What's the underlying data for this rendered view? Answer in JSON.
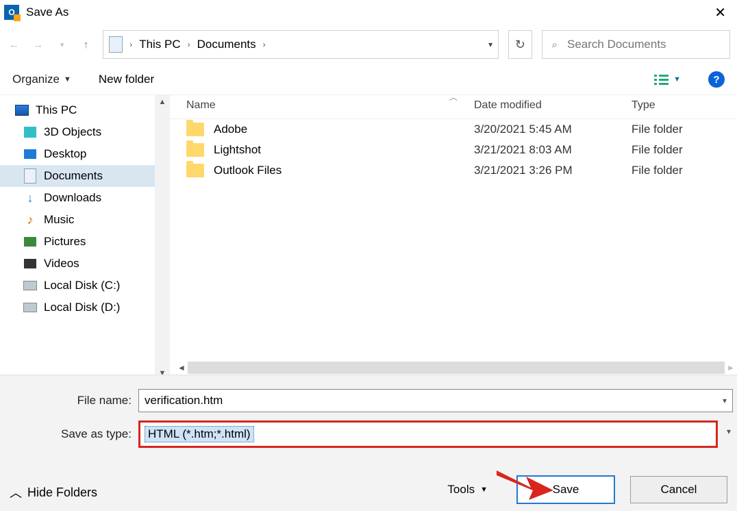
{
  "title": "Save As",
  "breadcrumb": {
    "root": "This PC",
    "current": "Documents"
  },
  "search": {
    "placeholder": "Search Documents"
  },
  "toolbar": {
    "organize": "Organize",
    "newfolder": "New folder"
  },
  "tree": {
    "thispc": "This PC",
    "objects3d": "3D Objects",
    "desktop": "Desktop",
    "documents": "Documents",
    "downloads": "Downloads",
    "music": "Music",
    "pictures": "Pictures",
    "videos": "Videos",
    "diskc": "Local Disk (C:)",
    "diskd": "Local Disk (D:)"
  },
  "columns": {
    "name": "Name",
    "modified": "Date modified",
    "type": "Type"
  },
  "files": [
    {
      "name": "Adobe",
      "modified": "3/20/2021 5:45 AM",
      "type": "File folder"
    },
    {
      "name": "Lightshot",
      "modified": "3/21/2021 8:03 AM",
      "type": "File folder"
    },
    {
      "name": "Outlook Files",
      "modified": "3/21/2021 3:26 PM",
      "type": "File folder"
    }
  ],
  "labels": {
    "filename": "File name:",
    "saveas": "Save as type:",
    "tools": "Tools",
    "hide": "Hide Folders"
  },
  "filename": "verification.htm",
  "savetype": "HTML (*.htm;*.html)",
  "buttons": {
    "save": "Save",
    "cancel": "Cancel"
  }
}
